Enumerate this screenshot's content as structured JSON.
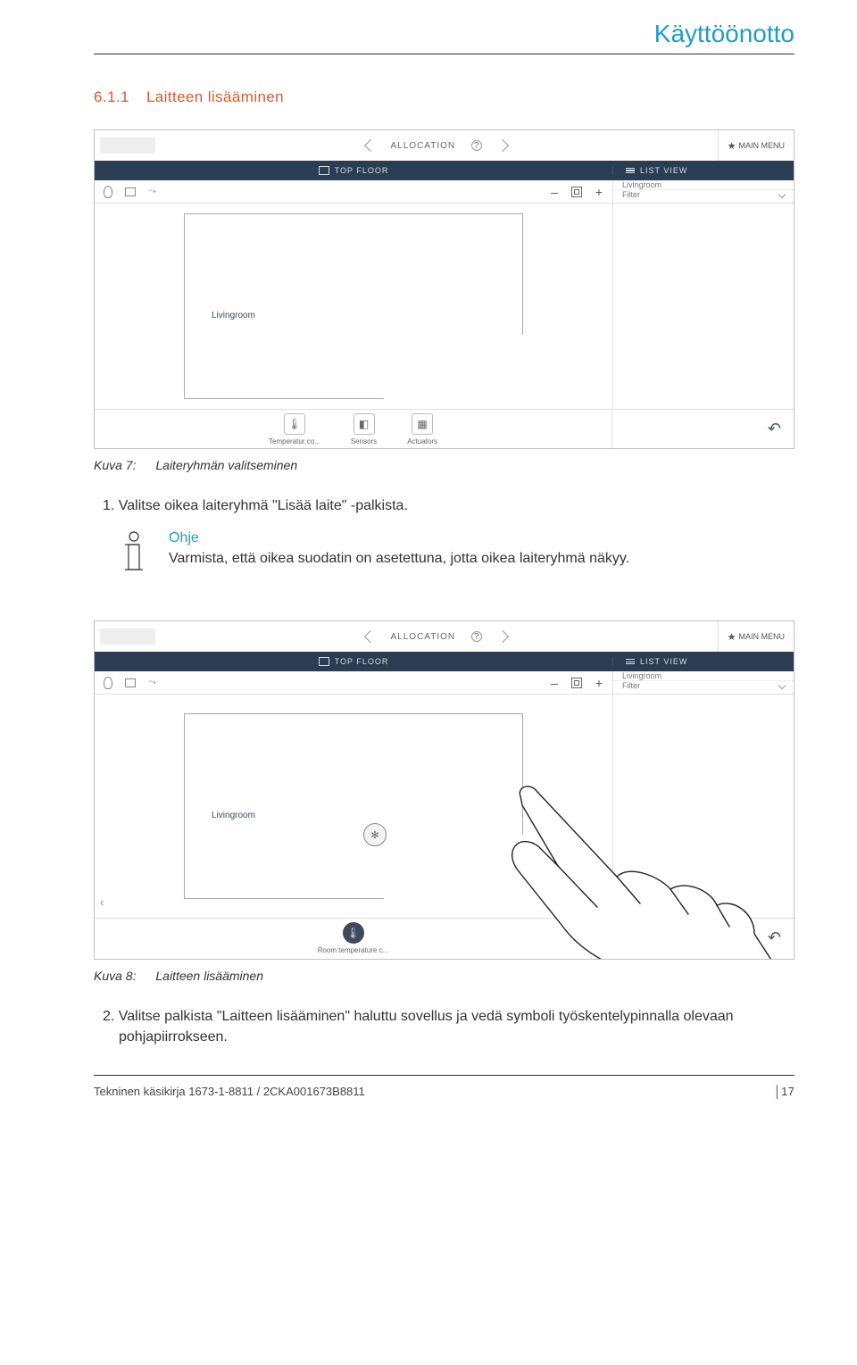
{
  "header": {
    "title": "Käyttöönotto"
  },
  "section": {
    "number": "6.1.1",
    "title": "Laitteen lisääminen"
  },
  "screenshot1": {
    "mainmenu": "MAIN MENU",
    "allocation": "ALLOCATION",
    "darkbar": {
      "topfloor": "TOP FLOOR",
      "listview": "LIST VIEW"
    },
    "side": {
      "livingroom": "Livingroom",
      "filter": "Filter"
    },
    "canvas": {
      "roomlabel": "Livingroom"
    },
    "tools": {
      "temp": "Temperatur co...",
      "sensors": "Sensors",
      "actuators": "Actuators"
    }
  },
  "caption1": {
    "label": "Kuva 7:",
    "text": "Laiteryhmän valitseminen"
  },
  "step1": "1. Valitse oikea laiteryhmä \"Lisää laite\" -palkista.",
  "note": {
    "heading": "Ohje",
    "text": "Varmista, että oikea suodatin on asetettuna, jotta oikea laiteryhmä näkyy."
  },
  "screenshot2": {
    "mainmenu": "MAIN MENU",
    "allocation": "ALLOCATION",
    "darkbar": {
      "topfloor": "TOP FLOOR",
      "listview": "LIST VIEW"
    },
    "side": {
      "livingroom": "Livingroom",
      "filter": "Filter"
    },
    "canvas": {
      "roomlabel": "Livingroom"
    },
    "tools": {
      "roomtemp": "Room temperature c..."
    }
  },
  "caption2": {
    "label": "Kuva 8:",
    "text": "Laitteen lisääminen"
  },
  "step2": "2. Valitse palkista \"Laitteen lisääminen\" haluttu sovellus ja vedä symboli työskentelypinnalla olevaan pohjapiirrokseen.",
  "footer": {
    "left": "Tekninen käsikirja 1673-1-8811 / 2CKA001673B8811",
    "right": "│17"
  }
}
